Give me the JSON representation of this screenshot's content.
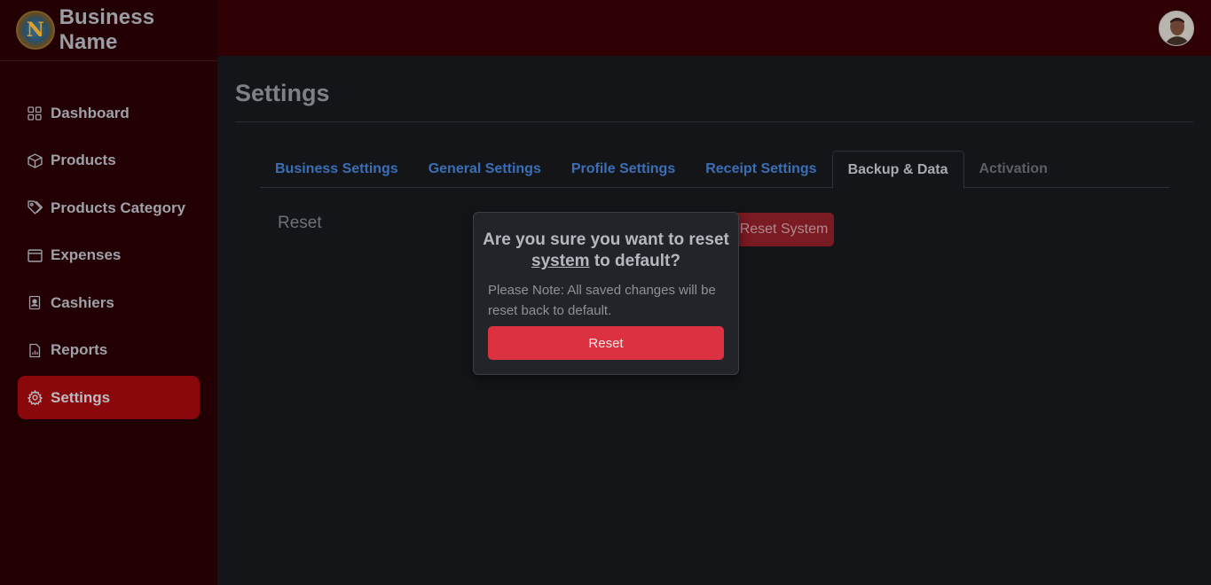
{
  "brand": {
    "name": "Business Name",
    "logo_letter": "N"
  },
  "sidebar": {
    "items": [
      {
        "label": "Dashboard",
        "icon": "grid-icon"
      },
      {
        "label": "Products",
        "icon": "box-icon"
      },
      {
        "label": "Products Category",
        "icon": "tags-icon"
      },
      {
        "label": "Expenses",
        "icon": "window-icon"
      },
      {
        "label": "Cashiers",
        "icon": "person-badge-icon"
      },
      {
        "label": "Reports",
        "icon": "file-chart-icon"
      },
      {
        "label": "Settings",
        "icon": "gear-icon",
        "active": true
      }
    ]
  },
  "page": {
    "title": "Settings"
  },
  "tabs": [
    {
      "label": "Business Settings"
    },
    {
      "label": "General Settings"
    },
    {
      "label": "Profile Settings"
    },
    {
      "label": "Receipt Settings"
    },
    {
      "label": "Backup & Data",
      "active": true
    },
    {
      "label": "Activation",
      "disabled": true
    }
  ],
  "reset_section": {
    "label": "Reset",
    "button_label": "Reset System"
  },
  "confirm_popover": {
    "title_pre": "Are you sure you want to reset ",
    "title_underlined": "system",
    "title_post": " to default?",
    "note": "Please Note: All saved changes will be reset back to default.",
    "button_label": "Reset"
  },
  "colors": {
    "sidebar_bg": "#230003",
    "topbar_bg": "#2f0004",
    "active_nav": "#8a070b",
    "danger": "#dc3140",
    "tab_link": "#3a6fb8"
  }
}
